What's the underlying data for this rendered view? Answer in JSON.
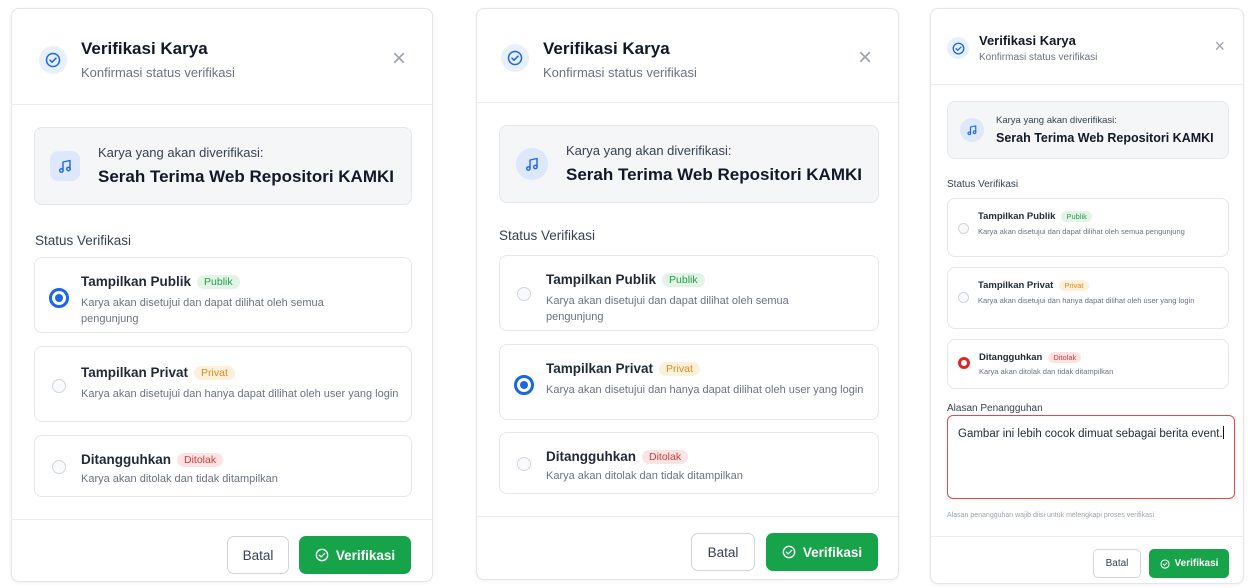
{
  "dialog": {
    "title": "Verifikasi Karya",
    "subtitle": "Konfirmasi status verifikasi",
    "close_symbol": "×",
    "work_label": "Karya yang akan diverifikasi:",
    "work_title": "Serah Terima Web Repositori KAMKI",
    "status_label": "Status Verifikasi",
    "options": [
      {
        "title": "Tampilkan Publik",
        "badge": "Publik",
        "desc": "Karya akan disetujui dan dapat dilihat oleh semua pengunjung",
        "badge_color": "#22a04b"
      },
      {
        "title": "Tampilkan Privat",
        "badge": "Privat",
        "desc": "Karya akan disetujui dan hanya dapat dilihat oleh user yang login",
        "badge_color": "#d98c1a"
      },
      {
        "title": "Ditangguhkan",
        "badge": "Ditolak",
        "desc": "Karya akan ditolak dan tidak ditampilkan",
        "badge_color": "#d43a3a"
      }
    ],
    "reason_label": "Alasan Penangguhan",
    "reason_value": "Gambar ini lebih cocok dimuat sebagai berita event.",
    "reason_hint": "Alasan penangguhan wajib diisi untuk melengkapi proses verifikasi",
    "cancel_label": "Batal",
    "verify_label": "Verifikasi",
    "accent_color": "#1a66e6",
    "verify_color": "#16a34a"
  },
  "panels": [
    {
      "selected_option": "Tampilkan Publik"
    },
    {
      "selected_option": "Tampilkan Privat"
    },
    {
      "selected_option": "Ditangguhkan"
    }
  ],
  "icons": {
    "header": "check-circle-icon",
    "work": "music-note-icon",
    "close": "close-icon",
    "verify": "check-circle-icon"
  }
}
